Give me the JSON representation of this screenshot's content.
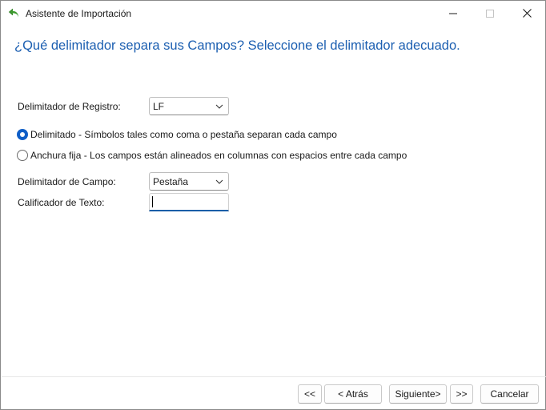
{
  "window": {
    "title": "Asistente de Importación",
    "app_icon": "green-undo-arrow-icon"
  },
  "heading": "¿Qué delimitador separa sus Campos? Seleccione el delimitador adecuado.",
  "record_delimiter": {
    "label": "Delimitador de Registro:",
    "value": "LF"
  },
  "mode_options": [
    {
      "label": "Delimitado - Símbolos tales como coma o pestaña separan cada campo",
      "selected": true
    },
    {
      "label": "Anchura fija - Los campos están alineados en columnas con espacios entre cada campo",
      "selected": false
    }
  ],
  "field_delimiter": {
    "label": "Delimitador de Campo:",
    "value": "Pestaña"
  },
  "text_qualifier": {
    "label": "Calificador de Texto:",
    "value": ""
  },
  "buttons": {
    "first": "<<",
    "back": "< Atrás",
    "next": "Siguiente>",
    "last": ">>",
    "cancel": "Cancelar"
  },
  "colors": {
    "heading": "#1c5fb1",
    "radio_selected": "#0f5ec7",
    "focus_underline": "#1a5fa8"
  }
}
